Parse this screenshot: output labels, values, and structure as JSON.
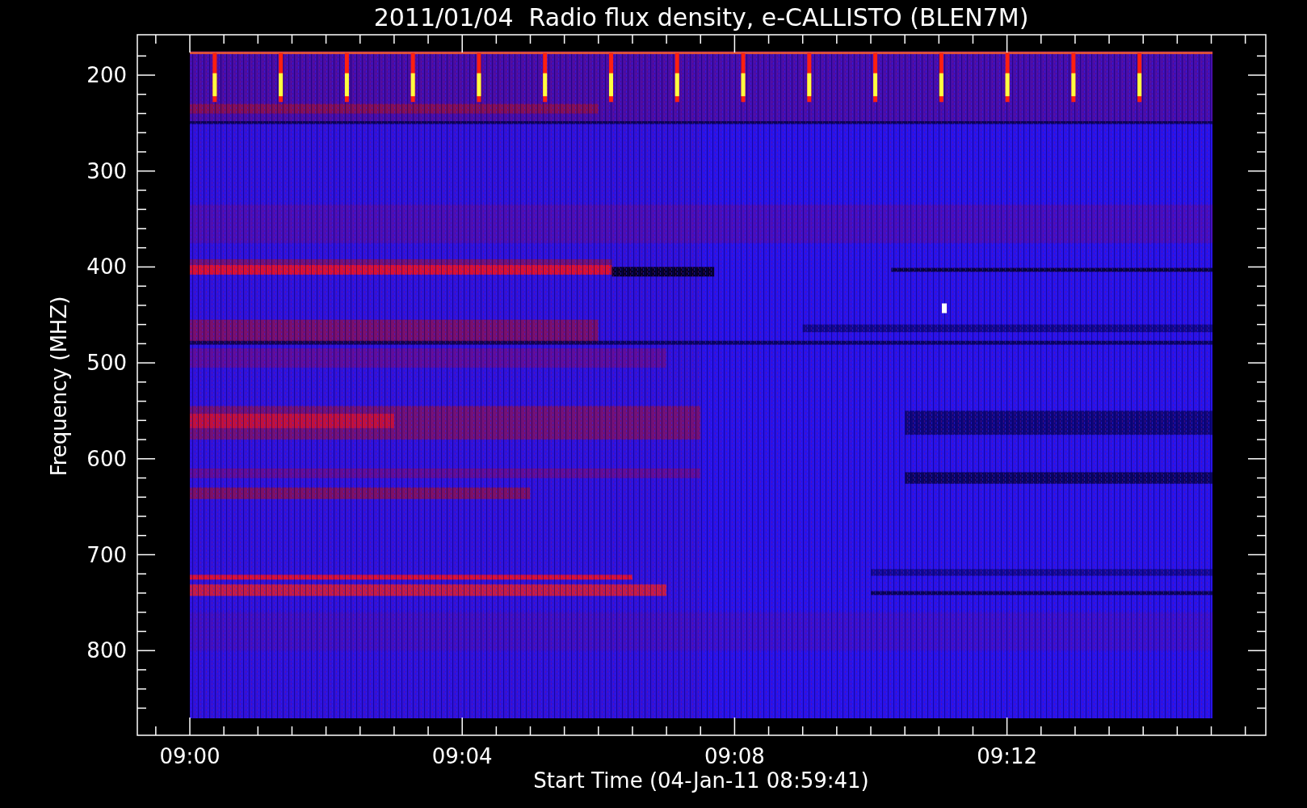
{
  "title": "2011/01/04  Radio flux density, e-CALLISTO (BLEN7M)",
  "xaxis": {
    "label": "Start Time (04-Jan-11 08:59:41)",
    "ticks": [
      "09:00",
      "09:04",
      "09:08",
      "09:12"
    ]
  },
  "yaxis": {
    "label": "Frequency (MHZ)",
    "ticks": [
      "200",
      "300",
      "400",
      "500",
      "600",
      "700",
      "800"
    ]
  }
}
